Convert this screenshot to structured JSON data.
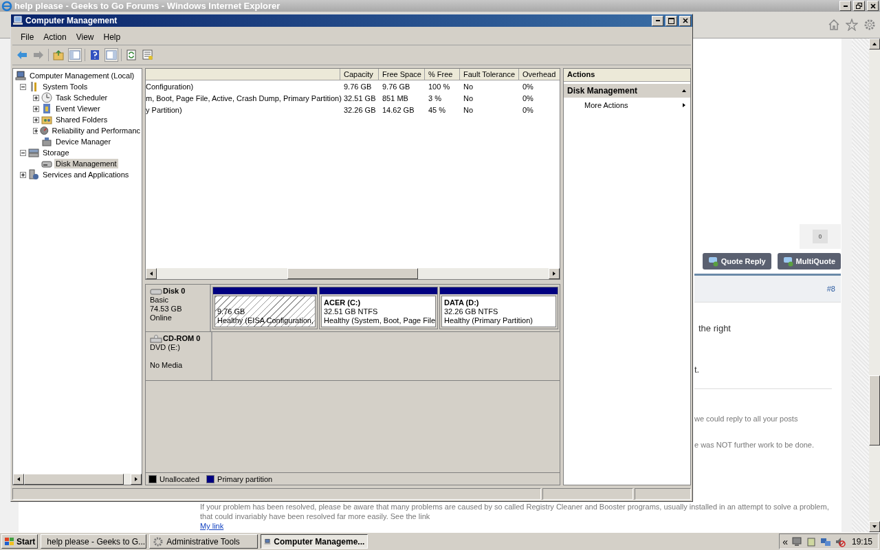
{
  "browser": {
    "title": "help please - Geeks to Go Forums - Windows Internet Explorer",
    "post": {
      "count": "0",
      "buttons": [
        "Quote Reply",
        "MultiQuote"
      ],
      "post_number": "#8",
      "fragments": [
        "the right",
        "t.",
        "we could reply to all your posts",
        "e was NOT further work to be done."
      ],
      "footer": [
        "If your problem has been resolved, please be aware that many problems are caused by so called Registry Cleaner and Booster programs, usually installed in an attempt to solve a problem,",
        "that could invariably have been resolved far more easily. See the link"
      ],
      "link": "My link"
    }
  },
  "window": {
    "title": "Computer Management",
    "menu": [
      "File",
      "Action",
      "View",
      "Help"
    ],
    "tree": [
      {
        "label": "Computer Management (Local)",
        "selected": false,
        "children": [
          {
            "label": "System Tools",
            "expanded": true,
            "selected": false,
            "children": [
              {
                "label": "Task Scheduler",
                "expanded": false,
                "selected": false
              },
              {
                "label": "Event Viewer",
                "expanded": false,
                "selected": false
              },
              {
                "label": "Shared Folders",
                "expanded": false,
                "selected": false
              },
              {
                "label": "Reliability and Performanc",
                "expanded": false,
                "selected": false
              },
              {
                "label": "Device Manager",
                "selected": false
              }
            ]
          },
          {
            "label": "Storage",
            "expanded": true,
            "selected": false,
            "children": [
              {
                "label": "Disk Management",
                "selected": true
              }
            ]
          },
          {
            "label": "Services and Applications",
            "expanded": false,
            "selected": false
          }
        ]
      }
    ],
    "columns": [
      "",
      "Capacity",
      "Free Space",
      "% Free",
      "Fault Tolerance",
      "Overhead"
    ],
    "rows": [
      {
        "cells": [
          "Configuration)",
          "9.76 GB",
          "9.76 GB",
          "100 %",
          "No",
          "0%"
        ]
      },
      {
        "cells": [
          "m, Boot, Page File, Active, Crash Dump, Primary Partition)",
          "32.51 GB",
          "851 MB",
          "3 %",
          "No",
          "0%"
        ]
      },
      {
        "cells": [
          "y Partition)",
          "32.26 GB",
          "14.62 GB",
          "45 %",
          "No",
          "0%"
        ]
      }
    ],
    "disks": [
      {
        "kind": "disk",
        "name": "Disk 0",
        "lines": [
          "Basic",
          "74.53 GB",
          "Online"
        ],
        "partitions": [
          {
            "kind": "eisa",
            "lines": [
              "9.76 GB",
              "Healthy (EISA Configuration,"
            ]
          },
          {
            "kind": "primary",
            "name": "ACER  (C:)",
            "lines": [
              "32.51 GB NTFS",
              "Healthy (System, Boot, Page File"
            ]
          },
          {
            "kind": "primary",
            "name": "DATA  (D:)",
            "lines": [
              "32.26 GB NTFS",
              "Healthy (Primary Partition)"
            ]
          }
        ]
      },
      {
        "kind": "cdrom",
        "name": "CD-ROM 0",
        "lines": [
          "DVD (E:)",
          "No Media"
        ]
      }
    ],
    "legend": [
      {
        "label": "Unallocated",
        "color": "#000000"
      },
      {
        "label": "Primary partition",
        "color": "#000080"
      }
    ],
    "actions": {
      "title": "Actions",
      "section": "Disk Management",
      "items": [
        "More Actions"
      ]
    }
  },
  "taskbar": {
    "start": "Start",
    "tasks": [
      {
        "label": "help please - Geeks to G...",
        "selected": false
      },
      {
        "label": "Administrative Tools",
        "selected": false
      },
      {
        "label": "Computer Manageme...",
        "selected": true
      }
    ],
    "expand": "«",
    "clock": "19:15"
  }
}
